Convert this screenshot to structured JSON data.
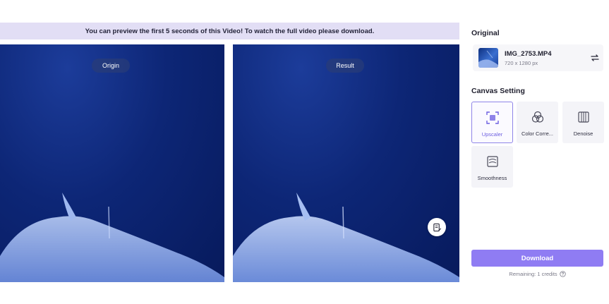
{
  "notice": {
    "text": "You can preview the first 5 seconds of this Video! To watch the full video please download."
  },
  "preview": {
    "origin_label": "Origin",
    "result_label": "Result",
    "edit_icon": "edit-note-icon"
  },
  "original": {
    "title": "Original",
    "file_name": "IMG_2753.MP4",
    "dimensions": "720 x 1280 px",
    "swap_icon": "swap-icon"
  },
  "canvas_setting": {
    "title": "Canvas Setting",
    "tools": [
      {
        "label": "Upscaler",
        "icon": "upscaler-icon",
        "selected": true
      },
      {
        "label": "Color Corre...",
        "icon": "color-correction-icon",
        "selected": false
      },
      {
        "label": "Denoise",
        "icon": "denoise-icon",
        "selected": false
      },
      {
        "label": "Smoothness",
        "icon": "smoothness-icon",
        "selected": false
      }
    ]
  },
  "footer": {
    "download_label": "Download",
    "remaining_text": "Remaining: 1 credits"
  },
  "colors": {
    "accent": "#8f7cf3",
    "notice_bg": "#e2def5",
    "video_blue": "#0d2676"
  }
}
